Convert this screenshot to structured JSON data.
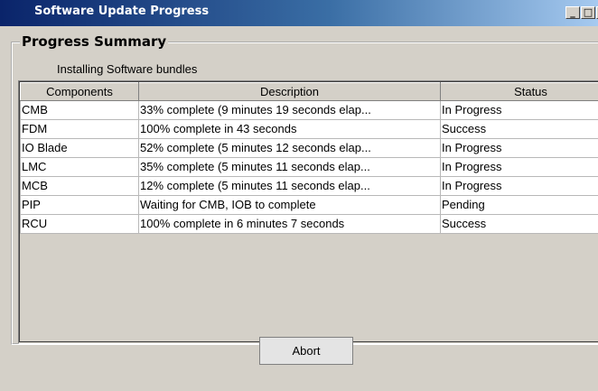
{
  "window": {
    "title": "Software Update Progress",
    "min_glyph": "_",
    "max_glyph": "□",
    "close_glyph": "×"
  },
  "group": {
    "legend": "Progress Summary"
  },
  "subtitle": "Installing Software bundles",
  "table": {
    "columns": [
      "Components",
      "Description",
      "Status"
    ],
    "rows": [
      {
        "component": "CMB",
        "description": "33% complete (9 minutes 19 seconds elap...",
        "status": "In Progress"
      },
      {
        "component": "FDM",
        "description": "100% complete in 43 seconds",
        "status": "Success"
      },
      {
        "component": "IO Blade",
        "description": "52% complete (5 minutes 12 seconds elap...",
        "status": "In Progress"
      },
      {
        "component": "LMC",
        "description": "35% complete (5 minutes 11 seconds elap...",
        "status": "In Progress"
      },
      {
        "component": "MCB",
        "description": "12% complete (5 minutes 11 seconds elap...",
        "status": "In Progress"
      },
      {
        "component": "PIP",
        "description": "Waiting for CMB, IOB to complete",
        "status": "Pending"
      },
      {
        "component": "RCU",
        "description": "100% complete in 6 minutes 7 seconds",
        "status": "Success"
      }
    ]
  },
  "actions": {
    "abort_label": "Abort"
  },
  "colors": {
    "titlebar_start": "#0a246a",
    "titlebar_end": "#a6caf0",
    "window_bg": "#d4d0c8"
  }
}
